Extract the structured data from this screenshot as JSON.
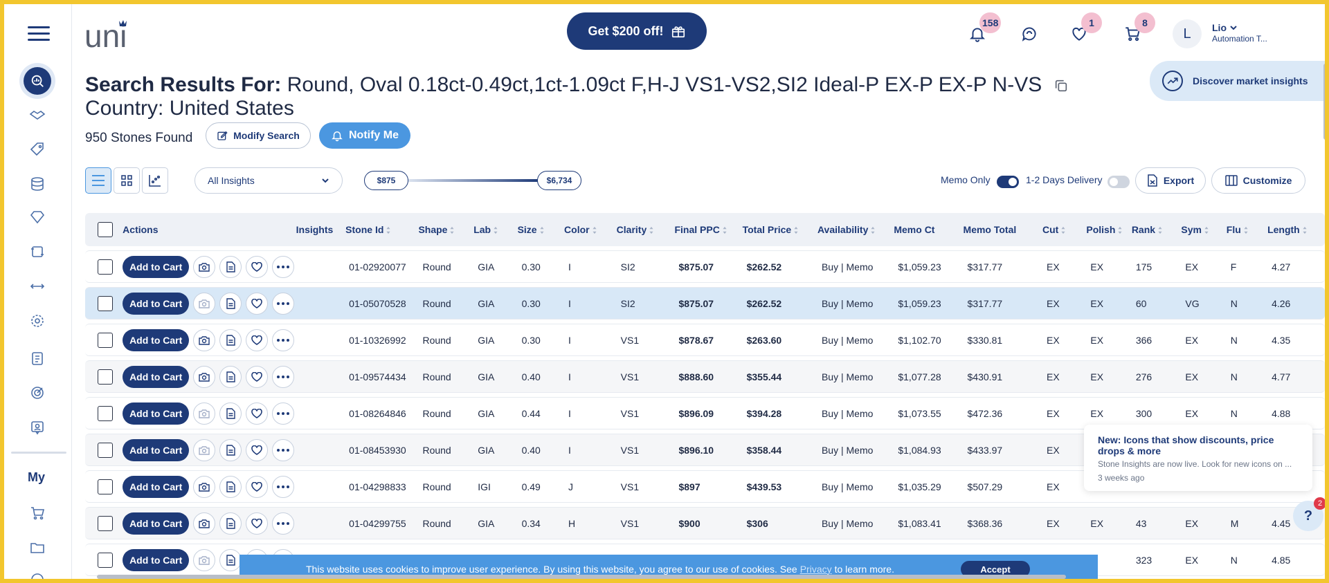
{
  "colors": {
    "accent": "#1e3a78",
    "primary_light": "#4b97e0",
    "highlight_row": "#d8e8f7",
    "badge": "#f3bfd0",
    "frame": "#f2c62e"
  },
  "sidebar": {
    "icons": [
      "analytics-icon",
      "handshake-icon",
      "tag-icon",
      "database-icon",
      "diamond-icon",
      "crop-icon",
      "arrows-horizontal-icon",
      "settings-icon",
      "clipboard-icon",
      "target-icon",
      "badge-icon",
      "cart-icon",
      "folder-icon"
    ],
    "section_label": "My"
  },
  "header": {
    "logo_text": "uni",
    "promo_label": "Get $200 off!",
    "notifications_count": "158",
    "wishlist_count": "1",
    "cart_count": "8",
    "avatar_initial": "L",
    "user_name": "Lio",
    "user_role": "Automation T..."
  },
  "search": {
    "title_prefix": "Search Results For:",
    "criteria": "Round, Oval 0.18ct-0.49ct,1ct-1.09ct F,H-J VS1-VS2,SI2 Ideal-P EX-P EX-P N-VS",
    "country": "Country: United States",
    "stones_found": "950 Stones Found",
    "modify_label": "Modify Search",
    "notify_label": "Notify Me",
    "market_label": "Discover market insights"
  },
  "toolbar": {
    "insights_select": "All Insights",
    "price_min": "$875",
    "price_max": "$6,734",
    "memo_only_label": "Memo Only",
    "memo_only_on": true,
    "delivery_label": "1-2 Days Delivery",
    "delivery_on": false,
    "export_label": "Export",
    "customize_label": "Customize"
  },
  "table": {
    "headers": [
      "Actions",
      "Insights",
      "Stone Id",
      "Shape",
      "Lab",
      "Size",
      "Color",
      "Clarity",
      "Final PPC",
      "Total Price",
      "Availability",
      "Memo Ct",
      "Memo Total",
      "Cut",
      "Polish",
      "Rank",
      "Sym",
      "Flu",
      "Length"
    ],
    "add_label": "Add to Cart",
    "rows": [
      {
        "id": "01-02920077",
        "shape": "Round",
        "lab": "GIA",
        "size": "0.30",
        "color": "I",
        "clarity": "SI2",
        "ppc": "$875.07",
        "total": "$262.52",
        "avail": "Buy | Memo",
        "memo_ct": "$1,059.23",
        "memo_total": "$317.77",
        "cut": "EX",
        "polish": "EX",
        "rank": "175",
        "sym": "EX",
        "flu": "F",
        "length": "4.27"
      },
      {
        "id": "01-05070528",
        "shape": "Round",
        "lab": "GIA",
        "size": "0.30",
        "color": "I",
        "clarity": "SI2",
        "ppc": "$875.07",
        "total": "$262.52",
        "avail": "Buy | Memo",
        "memo_ct": "$1,059.23",
        "memo_total": "$317.77",
        "cut": "EX",
        "polish": "EX",
        "rank": "60",
        "sym": "VG",
        "flu": "N",
        "length": "4.26"
      },
      {
        "id": "01-10326992",
        "shape": "Round",
        "lab": "GIA",
        "size": "0.30",
        "color": "I",
        "clarity": "VS1",
        "ppc": "$878.67",
        "total": "$263.60",
        "avail": "Buy | Memo",
        "memo_ct": "$1,102.70",
        "memo_total": "$330.81",
        "cut": "EX",
        "polish": "EX",
        "rank": "366",
        "sym": "EX",
        "flu": "N",
        "length": "4.35"
      },
      {
        "id": "01-09574434",
        "shape": "Round",
        "lab": "GIA",
        "size": "0.40",
        "color": "I",
        "clarity": "VS1",
        "ppc": "$888.60",
        "total": "$355.44",
        "avail": "Buy | Memo",
        "memo_ct": "$1,077.28",
        "memo_total": "$430.91",
        "cut": "EX",
        "polish": "EX",
        "rank": "276",
        "sym": "EX",
        "flu": "N",
        "length": "4.77"
      },
      {
        "id": "01-08264846",
        "shape": "Round",
        "lab": "GIA",
        "size": "0.44",
        "color": "I",
        "clarity": "VS1",
        "ppc": "$896.09",
        "total": "$394.28",
        "avail": "Buy | Memo",
        "memo_ct": "$1,073.55",
        "memo_total": "$472.36",
        "cut": "EX",
        "polish": "EX",
        "rank": "300",
        "sym": "EX",
        "flu": "N",
        "length": "4.88"
      },
      {
        "id": "01-08453930",
        "shape": "Round",
        "lab": "GIA",
        "size": "0.40",
        "color": "I",
        "clarity": "VS1",
        "ppc": "$896.10",
        "total": "$358.44",
        "avail": "Buy | Memo",
        "memo_ct": "$1,084.93",
        "memo_total": "$433.97",
        "cut": "EX",
        "polish": "",
        "rank": "",
        "sym": "",
        "flu": "",
        "length": ""
      },
      {
        "id": "01-04298833",
        "shape": "Round",
        "lab": "IGI",
        "size": "0.49",
        "color": "J",
        "clarity": "VS1",
        "ppc": "$897",
        "total": "$439.53",
        "avail": "Buy | Memo",
        "memo_ct": "$1,035.29",
        "memo_total": "$507.29",
        "cut": "EX",
        "polish": "",
        "rank": "",
        "sym": "",
        "flu": "",
        "length": ""
      },
      {
        "id": "01-04299755",
        "shape": "Round",
        "lab": "GIA",
        "size": "0.34",
        "color": "H",
        "clarity": "VS1",
        "ppc": "$900",
        "total": "$306",
        "avail": "Buy | Memo",
        "memo_ct": "$1,083.41",
        "memo_total": "$368.36",
        "cut": "EX",
        "polish": "EX",
        "rank": "43",
        "sym": "EX",
        "flu": "M",
        "length": "4.45"
      },
      {
        "id": "",
        "shape": "",
        "lab": "",
        "size": "",
        "color": "",
        "clarity": "",
        "ppc": "",
        "total": "",
        "avail": "",
        "memo_ct": "",
        "memo_total": "",
        "cut": "",
        "polish": "",
        "rank": "323",
        "sym": "EX",
        "flu": "N",
        "length": "4.85"
      }
    ]
  },
  "popup": {
    "title": "New: Icons that show discounts, price drops & more",
    "body": "Stone Insights are now live. Look for new icons on ...",
    "time": "3 weeks ago"
  },
  "help": {
    "label": "?",
    "badge": "2"
  },
  "cookie": {
    "text_before": "This website uses cookies to improve user experience. By using this website, you agree to our use of cookies. See",
    "link": "Privacy",
    "text_after": "to learn more.",
    "accept_label": "Accept"
  }
}
